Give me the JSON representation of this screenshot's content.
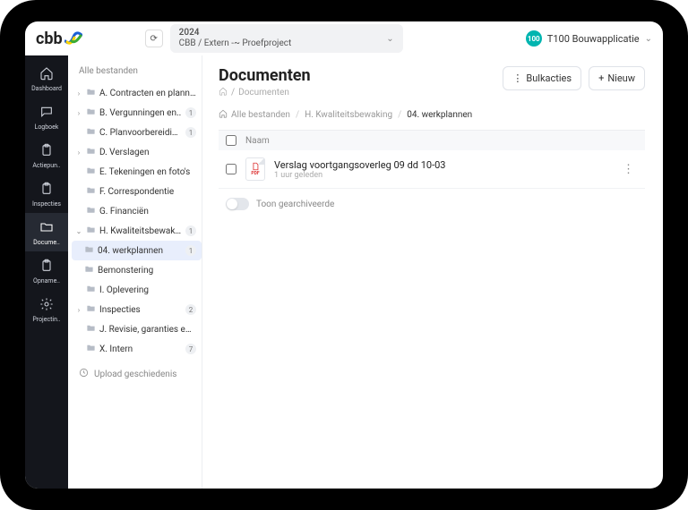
{
  "header": {
    "logo_text": "cbb",
    "project": {
      "year": "2024",
      "path": "CBB / Extern -~ Proefproject"
    },
    "user": {
      "avatar_text": "100",
      "name": "T100 Bouwapplicatie"
    }
  },
  "nav": [
    {
      "id": "dashboard",
      "label": "Dashboard",
      "icon": "home"
    },
    {
      "id": "logboek",
      "label": "Logboek",
      "icon": "chat"
    },
    {
      "id": "actiepun",
      "label": "Actiepun..",
      "icon": "clipboard"
    },
    {
      "id": "inspecties",
      "label": "Inspecties",
      "icon": "clipboard"
    },
    {
      "id": "docume",
      "label": "Docume..",
      "icon": "folder",
      "active": true
    },
    {
      "id": "opname",
      "label": "Opname..",
      "icon": "clipboard"
    },
    {
      "id": "projectin",
      "label": "Projectin..",
      "icon": "gear"
    }
  ],
  "tree": {
    "title": "Alle bestanden",
    "items": [
      {
        "label": "A. Contracten en planni..",
        "expandable": true,
        "expanded": false
      },
      {
        "label": "B. Vergunningen en..",
        "expandable": true,
        "expanded": false,
        "badge": "1"
      },
      {
        "label": "C. Planvoorbereiding",
        "expandable": false,
        "badge": "1"
      },
      {
        "label": "D. Verslagen",
        "expandable": true,
        "expanded": false
      },
      {
        "label": "E. Tekeningen en foto's",
        "expandable": false
      },
      {
        "label": "F. Correspondentie",
        "expandable": false
      },
      {
        "label": "G. Financiën",
        "expandable": false
      },
      {
        "label": "H. Kwaliteitsbewaki..",
        "expandable": true,
        "expanded": true,
        "badge": "1",
        "children": [
          {
            "label": "04. werkplannen",
            "badge": "1",
            "active": true
          },
          {
            "label": "Bemonstering"
          }
        ]
      },
      {
        "label": "I. Oplevering",
        "expandable": false
      },
      {
        "label": "Inspecties",
        "expandable": true,
        "expanded": false,
        "badge": "2"
      },
      {
        "label": "J. Revisie, garanties en ..",
        "expandable": false
      },
      {
        "label": "X. Intern",
        "expandable": false,
        "badge": "7"
      }
    ],
    "upload_history": "Upload geschiedenis"
  },
  "content": {
    "title": "Documenten",
    "sub_crumb": "Documenten",
    "bulk_label": "Bulkacties",
    "new_label": "Nieuw",
    "folder_crumbs": [
      "Alle bestanden",
      "H. Kwaliteitsbewaking",
      "04. werkplannen"
    ],
    "table": {
      "name_header": "Naam",
      "rows": [
        {
          "name": "Verslag voortgangsoverleg 09 dd 10-03",
          "time": "1 uur geleden",
          "type": "pdf"
        }
      ]
    },
    "archived_toggle_label": "Toon gearchiveerde"
  }
}
